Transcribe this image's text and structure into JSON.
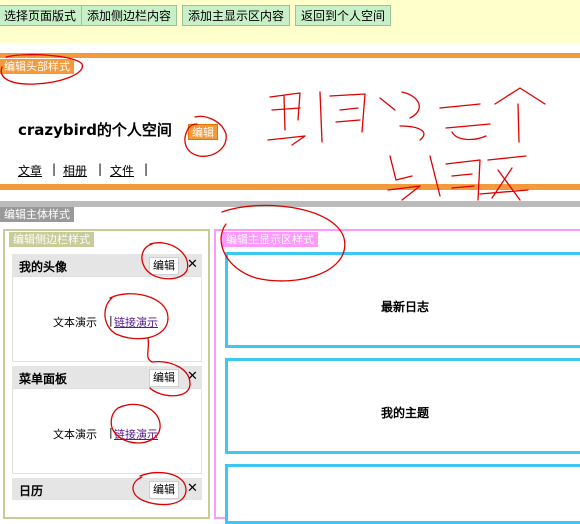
{
  "toolbar": {
    "buttons": [
      "选择页面版式",
      "添加侧边栏内容",
      "添加主显示区内容",
      "返回到个人空间"
    ]
  },
  "header": {
    "tag": "编辑头部样式",
    "title": "crazybird的个人空间",
    "edit": "编辑",
    "nav": [
      "文章",
      "相册",
      "文件"
    ],
    "nav_sep": "|"
  },
  "body_tag": "编辑主体样式",
  "sidebar": {
    "tag": "编辑侧边栏样式",
    "panels": [
      {
        "title": "我的头像",
        "edit": "编辑",
        "close": "✕",
        "text": "文本演示",
        "sep": "|",
        "link": "链接演示"
      },
      {
        "title": "菜单面板",
        "edit": "编辑",
        "close": "✕",
        "text": "文本演示",
        "sep": "|",
        "link": "链接演示"
      },
      {
        "title": "日历",
        "edit": "编辑",
        "close": "✕"
      }
    ]
  },
  "main": {
    "tag": "编辑主显示区样式",
    "blocks": [
      "最新日志",
      "我的主题"
    ]
  },
  "colors": {
    "toolbar_bg": "#ffffcc",
    "button_bg": "#c8f0c8",
    "header_bar": "#f39a3c",
    "sidebar_border": "#c8cc99",
    "main_border": "#ff99ff",
    "block_border": "#3cc8f0",
    "annotation": "#e00000"
  }
}
